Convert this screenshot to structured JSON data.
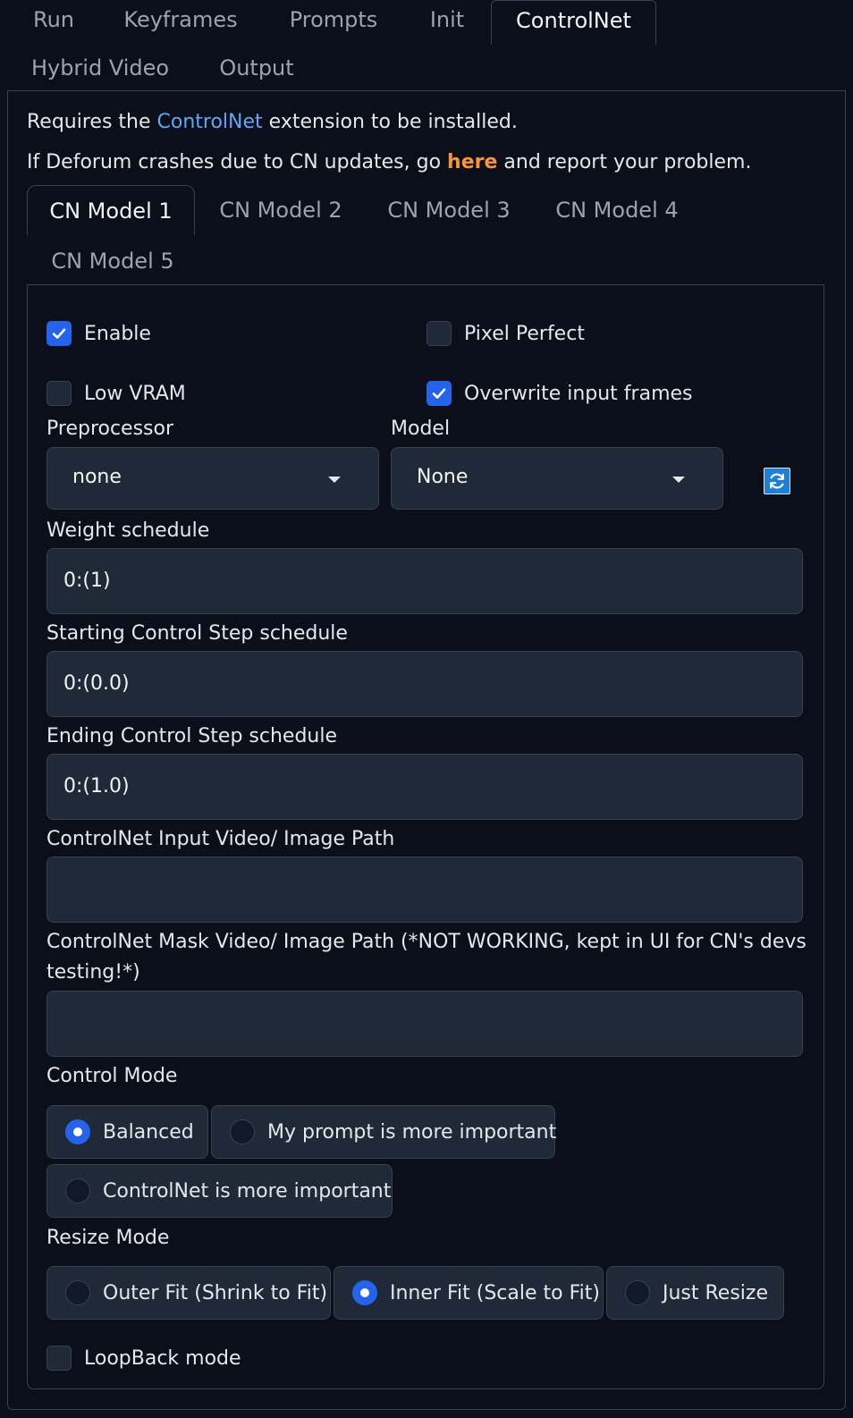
{
  "top_tabs": [
    {
      "label": "Run",
      "active": false
    },
    {
      "label": "Keyframes",
      "active": false
    },
    {
      "label": "Prompts",
      "active": false
    },
    {
      "label": "Init",
      "active": false
    },
    {
      "label": "ControlNet",
      "active": true
    },
    {
      "label": "Hybrid Video",
      "active": false
    },
    {
      "label": "Output",
      "active": false
    }
  ],
  "info": {
    "line1_prefix": "Requires the ",
    "line1_link": "ControlNet",
    "line1_suffix": " extension to be installed.",
    "line2_prefix": "If Deforum crashes due to CN updates, go ",
    "line2_link": "here",
    "line2_suffix": " and report your problem."
  },
  "cn_tabs": [
    {
      "label": "CN Model 1",
      "active": true
    },
    {
      "label": "CN Model 2",
      "active": false
    },
    {
      "label": "CN Model 3",
      "active": false
    },
    {
      "label": "CN Model 4",
      "active": false
    },
    {
      "label": "CN Model 5",
      "active": false
    }
  ],
  "checkboxes": {
    "enable": {
      "label": "Enable",
      "checked": true
    },
    "pixel_perfect": {
      "label": "Pixel Perfect",
      "checked": false
    },
    "low_vram": {
      "label": "Low VRAM",
      "checked": false
    },
    "overwrite_input_frames": {
      "label": "Overwrite input frames",
      "checked": true
    },
    "loopback_mode": {
      "label": "LoopBack mode",
      "checked": false
    }
  },
  "preprocessor": {
    "label": "Preprocessor",
    "value": "none"
  },
  "model": {
    "label": "Model",
    "value": "None"
  },
  "weight_schedule": {
    "label": "Weight schedule",
    "value": "0:(1)"
  },
  "starting_step": {
    "label": "Starting Control Step schedule",
    "value": "0:(0.0)"
  },
  "ending_step": {
    "label": "Ending Control Step schedule",
    "value": "0:(1.0)"
  },
  "input_video_path": {
    "label": "ControlNet Input Video/ Image Path",
    "value": ""
  },
  "mask_video_path": {
    "label_line1": "ControlNet Mask Video/ Image Path (*NOT WORKING, kept in UI for CN's devs",
    "label_line2": "testing!*)",
    "value": ""
  },
  "control_mode": {
    "label": "Control Mode",
    "options": [
      "Balanced",
      "My prompt is more important",
      "ControlNet is more important"
    ],
    "selected": "Balanced"
  },
  "resize_mode": {
    "label": "Resize Mode",
    "options": [
      "Outer Fit (Shrink to Fit)",
      "Inner Fit (Scale to Fit)",
      "Just Resize"
    ],
    "selected": "Inner Fit (Scale to Fit)"
  },
  "colors": {
    "accent": "#2563eb",
    "link_blue": "#60a5fa",
    "link_orange": "#fb923c",
    "background": "#0b0f19",
    "input_bg": "#1f2937"
  },
  "icons": {
    "check": "check-icon",
    "refresh": "refresh-icon",
    "caret": "chevron-down-icon"
  }
}
